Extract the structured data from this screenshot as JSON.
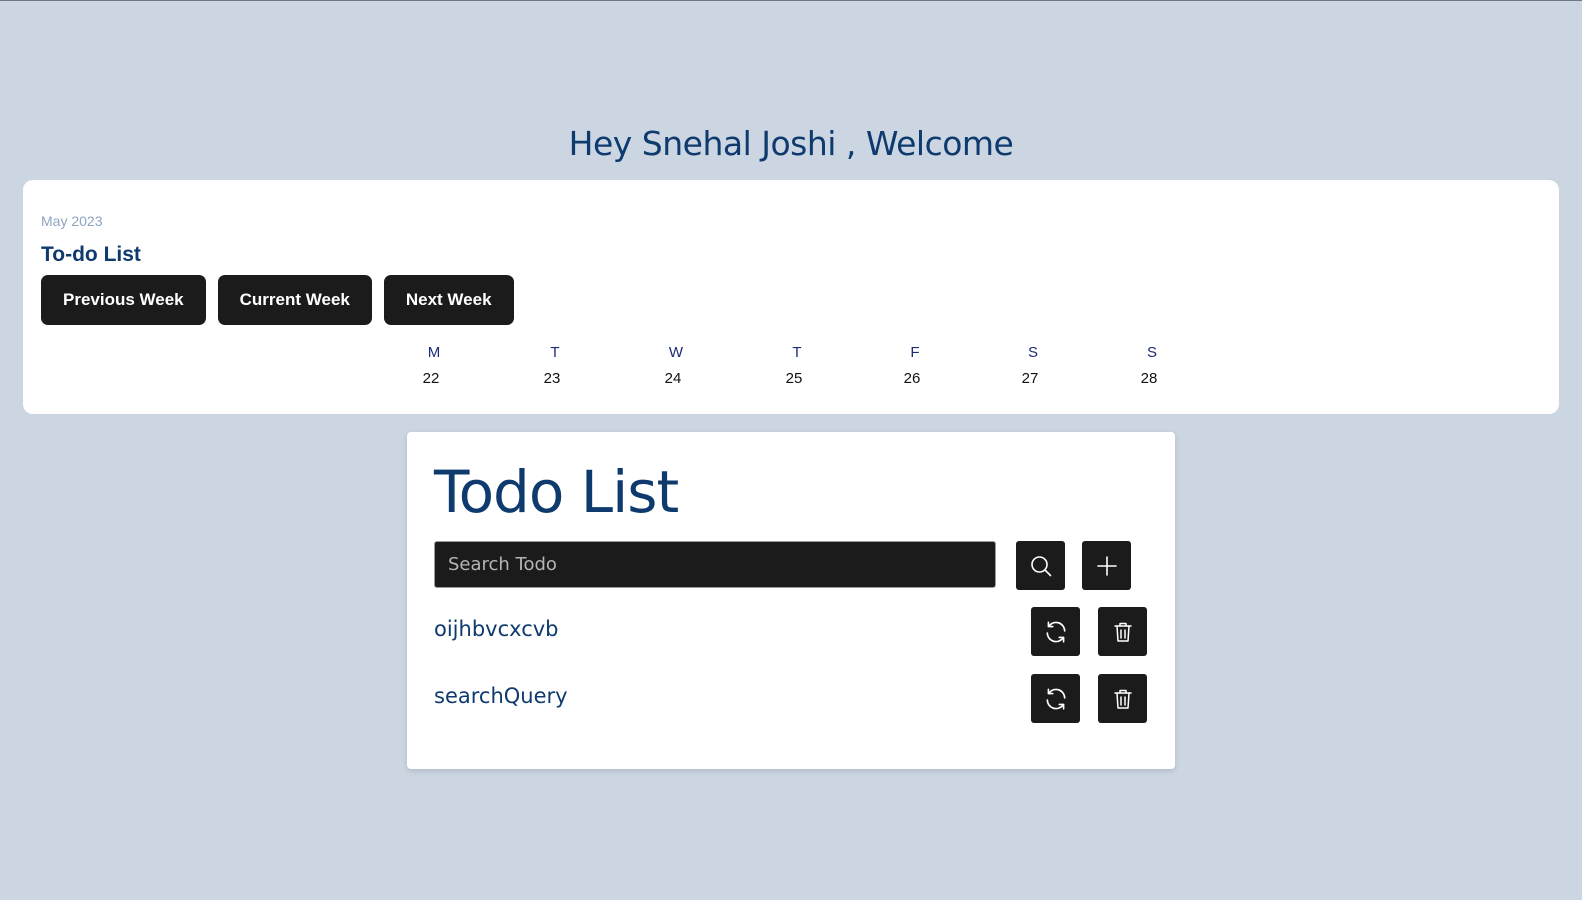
{
  "welcome": "Hey Snehal Joshi , Welcome",
  "week_card": {
    "month": "May 2023",
    "title": "To-do List",
    "buttons": {
      "previous": "Previous Week",
      "current": "Current Week",
      "next": "Next Week"
    },
    "days": [
      {
        "letter": "M",
        "date": "22"
      },
      {
        "letter": "T",
        "date": "23"
      },
      {
        "letter": "W",
        "date": "24"
      },
      {
        "letter": "T",
        "date": "25"
      },
      {
        "letter": "F",
        "date": "26"
      },
      {
        "letter": "S",
        "date": "27"
      },
      {
        "letter": "S",
        "date": "28"
      }
    ]
  },
  "todo_card": {
    "title": "Todo List",
    "search_placeholder": "Search Todo",
    "search_icon": "search-icon",
    "add_icon": "plus-icon",
    "items": [
      {
        "text": "oijhbvcxcvb",
        "update_icon": "refresh-icon",
        "delete_icon": "trash-icon"
      },
      {
        "text": "searchQuery",
        "update_icon": "refresh-icon",
        "delete_icon": "trash-icon"
      }
    ]
  }
}
